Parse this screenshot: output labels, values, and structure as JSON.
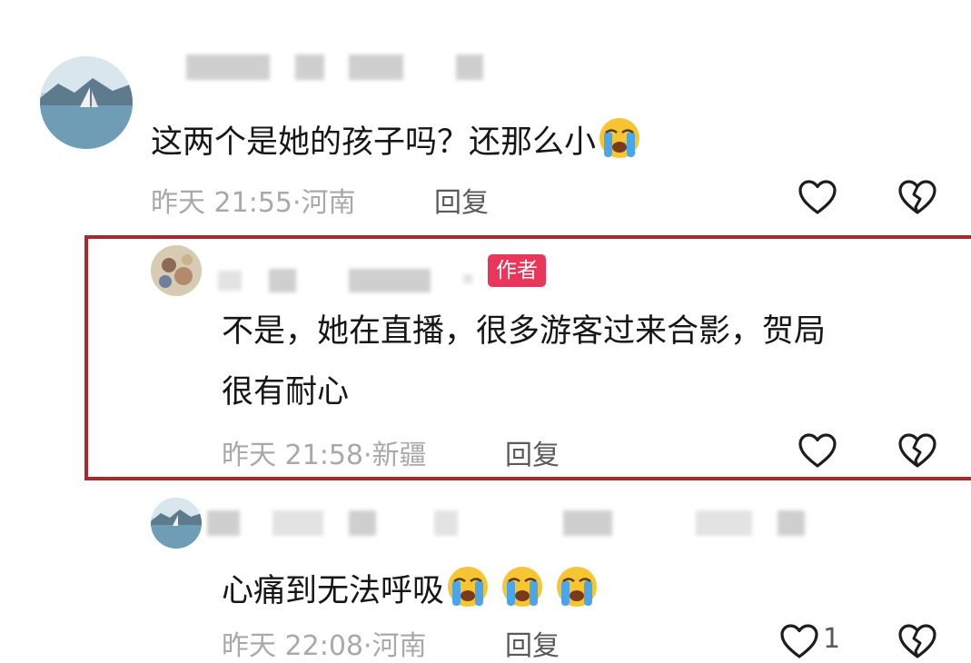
{
  "comments": [
    {
      "text": "这两个是她的孩子吗？还那么小",
      "time": "昨天 21:55",
      "location": "河南",
      "reply_label": "回复"
    },
    {
      "badge": "作者",
      "text_line1": "不是，她在直播，很多游客过来合影，贺局",
      "text_line2": "很有耐心",
      "time": "昨天 21:58",
      "location": "新疆",
      "reply_label": "回复"
    },
    {
      "text": "心痛到无法呼吸",
      "time": "昨天 22:08",
      "location": "河南",
      "reply_label": "回复",
      "like_count": "1"
    }
  ],
  "meta_separator": "·",
  "icons": [
    "avatar",
    "crying-emoji",
    "heart-icon",
    "broken-heart-icon"
  ],
  "colors": {
    "author_badge": "#e8375a",
    "highlight_border": "#a8282b",
    "meta_text": "#a9a9a9"
  }
}
